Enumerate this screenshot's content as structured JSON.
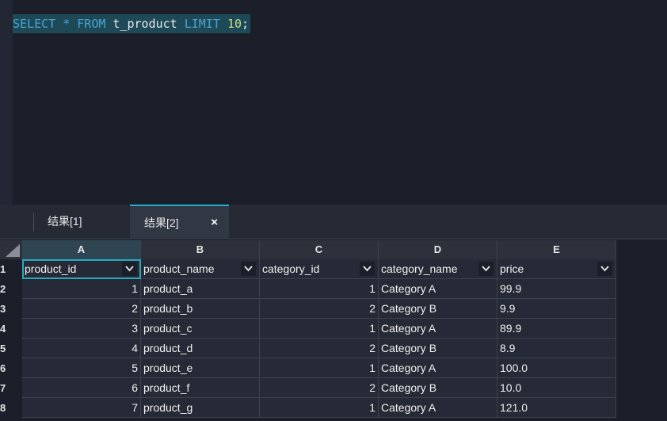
{
  "editor": {
    "tokens": [
      {
        "text": "SELECT",
        "kind": "kw"
      },
      {
        "text": " ",
        "kind": "id"
      },
      {
        "text": "*",
        "kind": "op"
      },
      {
        "text": " ",
        "kind": "id"
      },
      {
        "text": "FROM",
        "kind": "kw"
      },
      {
        "text": " t_product ",
        "kind": "id"
      },
      {
        "text": "LIMIT",
        "kind": "kw"
      },
      {
        "text": " ",
        "kind": "id"
      },
      {
        "text": "10",
        "kind": "num"
      },
      {
        "text": ";",
        "kind": "punc"
      }
    ]
  },
  "tabs": [
    {
      "label": "结果[1]"
    },
    {
      "label": "结果[2]",
      "close": "×"
    }
  ],
  "grid": {
    "column_letters": [
      "A",
      "B",
      "C",
      "D",
      "E"
    ],
    "headers": [
      "product_id",
      "product_name",
      "category_id",
      "category_name",
      "price"
    ],
    "row_numbers": [
      "1",
      "2",
      "3",
      "4",
      "5",
      "6",
      "7",
      "8"
    ],
    "rows": [
      [
        "1",
        "product_a",
        "1",
        "Category A",
        "99.9"
      ],
      [
        "2",
        "product_b",
        "2",
        "Category B",
        "9.9"
      ],
      [
        "3",
        "product_c",
        "1",
        "Category A",
        "89.9"
      ],
      [
        "4",
        "product_d",
        "2",
        "Category B",
        "8.9"
      ],
      [
        "5",
        "product_e",
        "1",
        "Category A",
        "100.0"
      ],
      [
        "6",
        "product_f",
        "2",
        "Category B",
        "10.0"
      ],
      [
        "7",
        "product_g",
        "1",
        "Category A",
        "121.0"
      ]
    ]
  },
  "icons": {
    "dropdown": "chevron-down-icon",
    "close": "close-icon",
    "select_all": "select-all-corner-icon"
  },
  "colors": {
    "accent": "#21b0c8",
    "keyword": "#4aa3d6",
    "number": "#c9d98a",
    "line_highlight": "#1e4a57"
  }
}
